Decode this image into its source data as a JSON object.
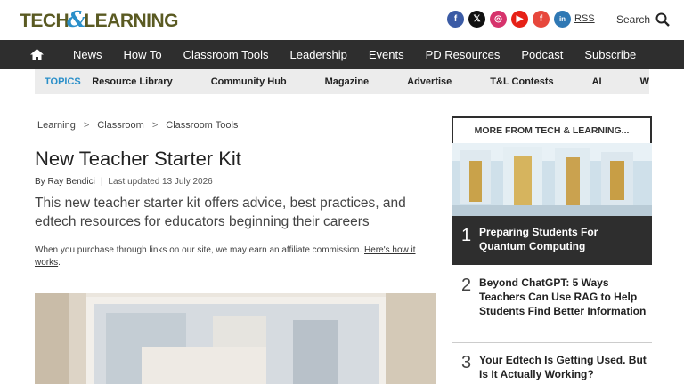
{
  "header": {
    "logo_left": "TECH",
    "logo_amp": "&",
    "logo_right": "LEARNING",
    "socials": [
      {
        "name": "facebook-icon",
        "glyph": "f"
      },
      {
        "name": "x-icon",
        "glyph": "𝕏"
      },
      {
        "name": "instagram-icon",
        "glyph": "◎"
      },
      {
        "name": "youtube-icon",
        "glyph": "▶"
      },
      {
        "name": "flipboard-icon",
        "glyph": "f"
      },
      {
        "name": "linkedin-icon",
        "glyph": "in"
      }
    ],
    "rss": "RSS",
    "search_label": "Search"
  },
  "nav": {
    "items": [
      "News",
      "How To",
      "Classroom Tools",
      "Leadership",
      "Events",
      "PD Resources",
      "Podcast",
      "Subscribe"
    ]
  },
  "topics": {
    "label": "TOPICS",
    "items": [
      "Resource Library",
      "Community Hub",
      "Magazine",
      "Advertise",
      "T&L Contests",
      "AI",
      "W"
    ]
  },
  "article": {
    "breadcrumbs": [
      "Learning",
      "Classroom",
      "Classroom Tools"
    ],
    "title": "New Teacher Starter Kit",
    "author": "By Ray Bendici",
    "updated": "Last updated 13 July 2026",
    "dek": "This new teacher starter kit offers advice, best practices, and edtech resources for educators beginning their careers",
    "disclaimer": "When you purchase through links on our site, we may earn an affiliate commission.",
    "disclaimer_link": "Here's how it works",
    "disclaimer_end": "."
  },
  "sidebar": {
    "heading": "MORE FROM TECH & LEARNING...",
    "featured": {
      "rank": "1",
      "title": "Preparing Students For Quantum Computing"
    },
    "items": [
      {
        "rank": "2",
        "title": "Beyond ChatGPT: 5 Ways Teachers Can Use RAG to Help Students Find Better Information"
      },
      {
        "rank": "3",
        "title": "Your Edtech Is Getting Used. But Is It Actually Working?"
      }
    ]
  },
  "colors": {
    "nav_bg": "#2e2e2e",
    "accent": "#2a8fc9",
    "logo": "#5a5a22"
  }
}
